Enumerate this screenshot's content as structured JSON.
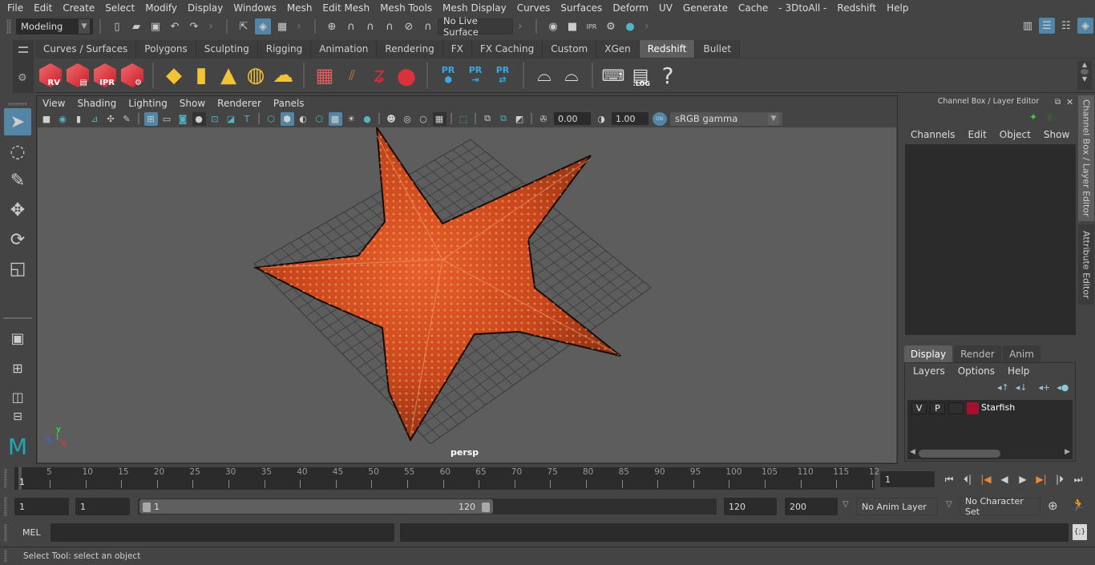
{
  "menubar": {
    "items": [
      "File",
      "Edit",
      "Create",
      "Select",
      "Modify",
      "Display",
      "Windows",
      "Mesh",
      "Edit Mesh",
      "Mesh Tools",
      "Mesh Display",
      "Curves",
      "Surfaces",
      "Deform",
      "UV",
      "Generate",
      "Cache",
      "- 3DtoAll -",
      "Redshift",
      "Help"
    ]
  },
  "statusline": {
    "mode_menu": "Modeling",
    "live_surface": "No Live Surface"
  },
  "shelf": {
    "tabs": [
      "Curves / Surfaces",
      "Polygons",
      "Sculpting",
      "Rigging",
      "Animation",
      "Rendering",
      "FX",
      "FX Caching",
      "Custom",
      "XGen",
      "Redshift",
      "Bullet"
    ],
    "active_tab": "Redshift",
    "rs_labels": {
      "rv": "RV",
      "ipr": "IPR",
      "pr": "PR",
      "log": ".LOG",
      "help": "?"
    }
  },
  "viewport": {
    "menu": [
      "View",
      "Shading",
      "Lighting",
      "Show",
      "Renderer",
      "Panels"
    ],
    "exposure": "0.00",
    "gamma": "1.00",
    "color_space": "sRGB gamma",
    "color_mgmt_badge": "ON",
    "camera_label": "persp",
    "axis": {
      "x": "x",
      "y": "y",
      "z": "z"
    },
    "model": "Starfish"
  },
  "channel_box": {
    "title": "Channel Box / Layer Editor",
    "menu": [
      "Channels",
      "Edit",
      "Object",
      "Show"
    ]
  },
  "layer_editor": {
    "tabs": [
      "Display",
      "Render",
      "Anim"
    ],
    "active_tab": "Display",
    "menu": [
      "Layers",
      "Options",
      "Help"
    ],
    "layers": [
      {
        "visible": "V",
        "playback": "P",
        "type": "",
        "color": "#a3112e",
        "name": "Starfish"
      }
    ]
  },
  "side_tabs": [
    "Channel Box / Layer Editor",
    "Attribute Editor"
  ],
  "timeline": {
    "ticks": [
      "5",
      "10",
      "15",
      "20",
      "25",
      "30",
      "35",
      "40",
      "45",
      "50",
      "55",
      "60",
      "65",
      "70",
      "75",
      "80",
      "85",
      "90",
      "95",
      "100",
      "105",
      "110",
      "115",
      "12"
    ],
    "current_frame_marker": "1",
    "current_frame": "1"
  },
  "range": {
    "start_frame": "1",
    "playback_start": "1",
    "range_start_label": "1",
    "range_end_label": "120",
    "playback_end": "120",
    "end_frame": "200",
    "anim_layer": "No Anim Layer",
    "character_set": "No Character Set"
  },
  "command_line": {
    "language": "MEL",
    "input": "",
    "output": ""
  },
  "help_line": {
    "text": "Select Tool: select an object"
  },
  "colors": {
    "accent": "#5285a6",
    "teal": "#52b5c4",
    "redshift_red": "#d8323c",
    "layer_color": "#a3112e",
    "keyframe_orange": "#e8893a"
  }
}
